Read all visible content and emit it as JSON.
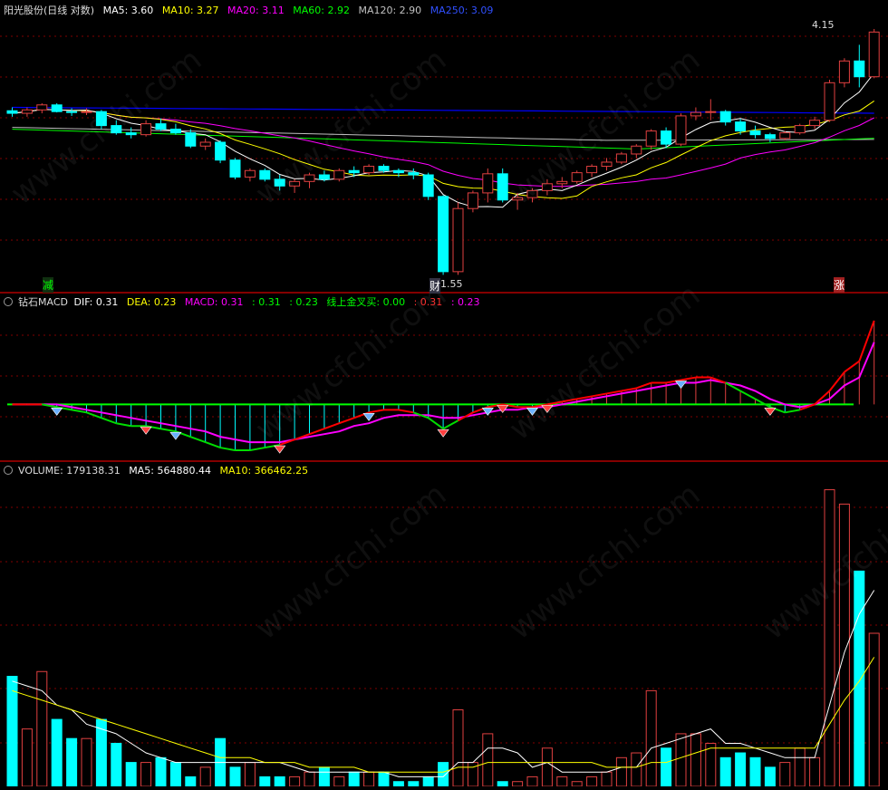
{
  "colors": {
    "up": "#e04040",
    "down": "#00ffff",
    "ma5": "#ffffff",
    "ma10": "#ffff00",
    "ma20": "#ff00ff",
    "ma60": "#00ff00",
    "ma120": "#c0c0c0",
    "ma250": "#0000ff",
    "dif": "#ff0000",
    "dea": "#ff00ff",
    "grid": "#800000"
  },
  "main": {
    "title": "阳光股份(日线 对数)",
    "ma5_label": "MA5: 3.60",
    "ma10_label": "MA10: 3.27",
    "ma20_label": "MA20: 3.11",
    "ma60_label": "MA60: 2.92",
    "ma120_label": "MA120: 2.90",
    "ma250_label": "MA250: 3.09",
    "high_label": "4.15",
    "low_label": "1.55",
    "marker_left": "减",
    "marker_mid": "财",
    "marker_right": "涨"
  },
  "macd": {
    "title": "钻石MACD",
    "dif_label": "DIF: 0.31",
    "dea_label": "DEA: 0.23",
    "macd_label": "MACD: 0.31",
    "v1": ": 0.31",
    "v2": ": 0.23",
    "cross_label": "线上金叉买: 0.00",
    "v3": ": 0.31",
    "v4": ": 0.23"
  },
  "volume": {
    "title": "VOLUME: 179138.31",
    "ma5_label": "MA5: 564880.44",
    "ma10_label": "MA10: 366462.25"
  },
  "watermark": "www.cfchi.com",
  "chart_data": [
    {
      "type": "candlestick",
      "scale": "log",
      "ylim": [
        1.5,
        4.3
      ],
      "candles": [
        [
          3.01,
          3.05,
          2.94,
          2.98
        ],
        [
          2.98,
          3.05,
          2.94,
          3.02
        ],
        [
          3.02,
          3.1,
          2.98,
          3.08
        ],
        [
          3.08,
          3.1,
          2.99,
          3.0
        ],
        [
          3.0,
          3.04,
          2.95,
          2.99
        ],
        [
          2.99,
          3.04,
          2.96,
          3.0
        ],
        [
          3.0,
          3.02,
          2.8,
          2.84
        ],
        [
          2.84,
          2.9,
          2.74,
          2.76
        ],
        [
          2.76,
          2.82,
          2.7,
          2.74
        ],
        [
          2.74,
          2.9,
          2.72,
          2.86
        ],
        [
          2.86,
          2.92,
          2.78,
          2.8
        ],
        [
          2.8,
          2.86,
          2.74,
          2.76
        ],
        [
          2.76,
          2.8,
          2.6,
          2.62
        ],
        [
          2.62,
          2.7,
          2.58,
          2.66
        ],
        [
          2.66,
          2.68,
          2.45,
          2.48
        ],
        [
          2.48,
          2.5,
          2.3,
          2.32
        ],
        [
          2.32,
          2.4,
          2.28,
          2.38
        ],
        [
          2.38,
          2.4,
          2.28,
          2.3
        ],
        [
          2.3,
          2.34,
          2.2,
          2.24
        ],
        [
          2.24,
          2.3,
          2.18,
          2.28
        ],
        [
          2.28,
          2.36,
          2.22,
          2.34
        ],
        [
          2.34,
          2.38,
          2.28,
          2.3
        ],
        [
          2.3,
          2.4,
          2.28,
          2.38
        ],
        [
          2.38,
          2.42,
          2.32,
          2.36
        ],
        [
          2.36,
          2.44,
          2.34,
          2.42
        ],
        [
          2.42,
          2.44,
          2.36,
          2.38
        ],
        [
          2.38,
          2.4,
          2.32,
          2.36
        ],
        [
          2.36,
          2.4,
          2.3,
          2.34
        ],
        [
          2.34,
          2.36,
          2.12,
          2.15
        ],
        [
          2.15,
          2.16,
          1.58,
          1.6
        ],
        [
          1.6,
          2.1,
          1.58,
          2.05
        ],
        [
          2.05,
          2.2,
          2.02,
          2.18
        ],
        [
          2.18,
          2.4,
          2.1,
          2.35
        ],
        [
          2.35,
          2.4,
          2.1,
          2.12
        ],
        [
          2.12,
          2.18,
          2.04,
          2.14
        ],
        [
          2.14,
          2.22,
          2.1,
          2.2
        ],
        [
          2.2,
          2.3,
          2.16,
          2.26
        ],
        [
          2.26,
          2.32,
          2.22,
          2.28
        ],
        [
          2.28,
          2.38,
          2.26,
          2.36
        ],
        [
          2.36,
          2.44,
          2.32,
          2.42
        ],
        [
          2.42,
          2.5,
          2.38,
          2.46
        ],
        [
          2.46,
          2.56,
          2.44,
          2.54
        ],
        [
          2.54,
          2.64,
          2.5,
          2.62
        ],
        [
          2.62,
          2.8,
          2.58,
          2.78
        ],
        [
          2.78,
          2.82,
          2.6,
          2.64
        ],
        [
          2.64,
          2.98,
          2.62,
          2.95
        ],
        [
          2.95,
          3.05,
          2.9,
          2.99
        ],
        [
          2.99,
          3.15,
          2.9,
          3.0
        ],
        [
          3.0,
          3.02,
          2.84,
          2.88
        ],
        [
          2.88,
          2.92,
          2.74,
          2.78
        ],
        [
          2.78,
          2.84,
          2.7,
          2.74
        ],
        [
          2.74,
          2.76,
          2.66,
          2.7
        ],
        [
          2.7,
          2.78,
          2.68,
          2.76
        ],
        [
          2.76,
          2.86,
          2.74,
          2.84
        ],
        [
          2.84,
          2.94,
          2.8,
          2.9
        ],
        [
          2.9,
          3.4,
          2.88,
          3.36
        ],
        [
          3.36,
          3.7,
          3.3,
          3.66
        ],
        [
          3.66,
          3.9,
          3.3,
          3.44
        ],
        [
          3.44,
          4.15,
          3.42,
          4.1
        ]
      ]
    },
    {
      "type": "line",
      "series": [
        {
          "name": "DIF",
          "values": [
            0.0,
            0.0,
            0.0,
            -0.01,
            -0.02,
            -0.03,
            -0.05,
            -0.07,
            -0.08,
            -0.08,
            -0.09,
            -0.1,
            -0.12,
            -0.14,
            -0.16,
            -0.17,
            -0.17,
            -0.16,
            -0.15,
            -0.13,
            -0.11,
            -0.09,
            -0.07,
            -0.05,
            -0.03,
            -0.02,
            -0.02,
            -0.03,
            -0.05,
            -0.09,
            -0.06,
            -0.03,
            -0.01,
            0.0,
            -0.01,
            -0.01,
            0.0,
            0.01,
            0.02,
            0.03,
            0.04,
            0.05,
            0.06,
            0.08,
            0.08,
            0.09,
            0.1,
            0.1,
            0.08,
            0.05,
            0.02,
            -0.01,
            -0.03,
            -0.02,
            0.0,
            0.05,
            0.12,
            0.16,
            0.31
          ]
        },
        {
          "name": "DEA",
          "values": [
            0.0,
            0.0,
            0.0,
            0.0,
            -0.01,
            -0.02,
            -0.03,
            -0.04,
            -0.05,
            -0.06,
            -0.07,
            -0.08,
            -0.09,
            -0.1,
            -0.12,
            -0.13,
            -0.14,
            -0.14,
            -0.14,
            -0.13,
            -0.12,
            -0.11,
            -0.1,
            -0.08,
            -0.07,
            -0.05,
            -0.04,
            -0.04,
            -0.04,
            -0.05,
            -0.05,
            -0.04,
            -0.03,
            -0.02,
            -0.02,
            -0.01,
            -0.01,
            0.0,
            0.01,
            0.02,
            0.03,
            0.04,
            0.05,
            0.06,
            0.07,
            0.08,
            0.08,
            0.09,
            0.08,
            0.07,
            0.05,
            0.02,
            0.0,
            -0.01,
            0.0,
            0.02,
            0.07,
            0.1,
            0.23
          ]
        }
      ],
      "ylim": [
        -0.2,
        0.34
      ]
    },
    {
      "type": "bar",
      "series": [
        {
          "name": "VOLUME",
          "values": [
            0.23,
            0.12,
            0.24,
            0.14,
            0.1,
            0.1,
            0.14,
            0.09,
            0.05,
            0.05,
            0.06,
            0.05,
            0.02,
            0.04,
            0.1,
            0.04,
            0.05,
            0.02,
            0.02,
            0.02,
            0.03,
            0.04,
            0.02,
            0.03,
            0.03,
            0.03,
            0.01,
            0.01,
            0.02,
            0.05,
            0.16,
            0.05,
            0.11,
            0.01,
            0.01,
            0.02,
            0.08,
            0.02,
            0.01,
            0.02,
            0.03,
            0.06,
            0.07,
            0.2,
            0.08,
            0.11,
            0.11,
            0.09,
            0.06,
            0.07,
            0.06,
            0.04,
            0.05,
            0.08,
            0.06,
            0.62,
            0.59,
            0.45,
            0.32
          ]
        },
        {
          "name": "MA5",
          "values": [
            0.22,
            0.21,
            0.2,
            0.17,
            0.16,
            0.13,
            0.12,
            0.11,
            0.09,
            0.07,
            0.06,
            0.05,
            0.05,
            0.05,
            0.05,
            0.05,
            0.05,
            0.05,
            0.05,
            0.04,
            0.03,
            0.03,
            0.03,
            0.03,
            0.03,
            0.03,
            0.02,
            0.02,
            0.02,
            0.02,
            0.05,
            0.05,
            0.08,
            0.08,
            0.07,
            0.04,
            0.05,
            0.03,
            0.03,
            0.03,
            0.03,
            0.04,
            0.04,
            0.08,
            0.09,
            0.1,
            0.11,
            0.12,
            0.09,
            0.09,
            0.08,
            0.07,
            0.06,
            0.06,
            0.06,
            0.17,
            0.28,
            0.36,
            0.41
          ]
        },
        {
          "name": "MA10",
          "values": [
            0.2,
            0.19,
            0.18,
            0.17,
            0.16,
            0.15,
            0.14,
            0.13,
            0.12,
            0.11,
            0.1,
            0.09,
            0.08,
            0.07,
            0.06,
            0.06,
            0.06,
            0.05,
            0.05,
            0.05,
            0.04,
            0.04,
            0.04,
            0.04,
            0.03,
            0.03,
            0.03,
            0.03,
            0.03,
            0.03,
            0.04,
            0.04,
            0.05,
            0.05,
            0.05,
            0.05,
            0.05,
            0.05,
            0.05,
            0.05,
            0.04,
            0.04,
            0.04,
            0.05,
            0.05,
            0.06,
            0.07,
            0.08,
            0.08,
            0.08,
            0.08,
            0.08,
            0.08,
            0.08,
            0.08,
            0.13,
            0.18,
            0.22,
            0.27
          ]
        }
      ]
    }
  ]
}
